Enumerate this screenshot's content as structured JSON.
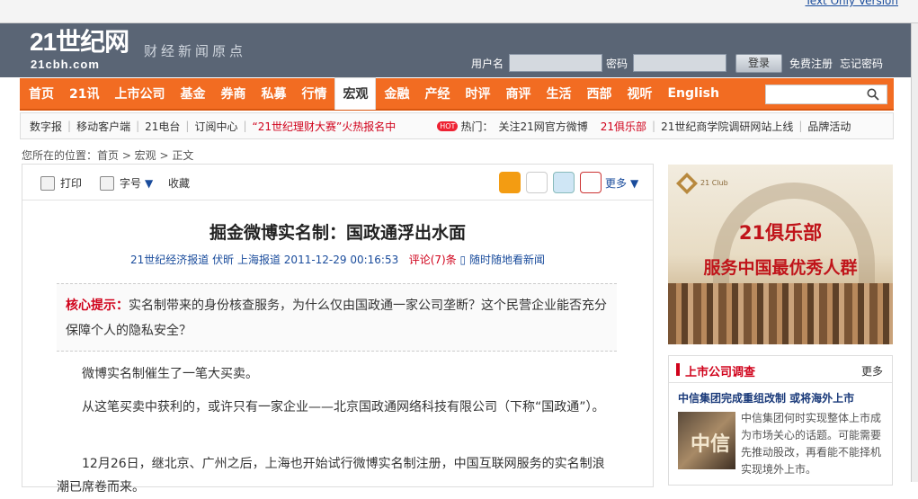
{
  "top": {
    "text_only_link": "Text Only Version"
  },
  "header": {
    "logo": "21世纪网",
    "logo_sub": "21cbh.com",
    "slogan": "财经新闻原点",
    "login": {
      "username_label": "用户名",
      "password_label": "密码",
      "login_button": "登录",
      "register": "免费注册",
      "forgot": "忘记密码"
    }
  },
  "nav": {
    "items": [
      "首页",
      "21讯",
      "上市公司",
      "基金",
      "券商",
      "私募",
      "行情",
      "宏观",
      "金融",
      "产经",
      "时评",
      "商评",
      "生活",
      "西部",
      "视听",
      "English"
    ],
    "active": "宏观"
  },
  "subnav": {
    "items": [
      "数字报",
      "移动客户端",
      "21电台",
      "订阅中心"
    ],
    "promo": "“21世纪理财大赛”火热报名中",
    "hot_badge": "HOT",
    "hot_label": "热门：",
    "hot_items": [
      "关注21网官方微博",
      "21俱乐部",
      "21世纪商学院调研网站上线"
    ],
    "brand": "品牌活动"
  },
  "breadcrumb": "您所在的位置：首页 > 宏观 >  正文",
  "toolbar": {
    "print": "打印",
    "font_size": "字号",
    "favorite": "收藏",
    "more": "更多"
  },
  "article": {
    "title": "掘金微博实名制：国政通浮出水面",
    "source": "21世纪经济报道",
    "author": "伏昕",
    "location": "上海报道",
    "datetime": "2011-12-29 00:16:53",
    "comments": "评论(7)条",
    "mobile": "随时随地看新闻",
    "summary_label": "核心提示：",
    "summary": "实名制带来的身份核查服务，为什么仅由国政通一家公司垄断？这个民营企业能否充分保障个人的隐私安全？",
    "paragraphs": [
      "微博实名制催生了一笔大买卖。",
      "从这笔买卖中获利的，或许只有一家企业——北京国政通网络科技有限公司（下称“国政通”）。",
      "12月26日，继北京、广州之后，上海也开始试行微博实名制注册，中国互联网服务的实名制浪潮已席卷而来。"
    ]
  },
  "ad": {
    "club_tag": "21 Club",
    "line1": "21俱乐部",
    "line2": "服务中国最优秀人群"
  },
  "sidebar": {
    "title": "上市公司调查",
    "more": "更多",
    "headline": "中信集团完成重组改制  或将海外上市",
    "image_text": "中信",
    "text": "中信集团何时实现整体上市成为市场关心的话题。可能需要先推动股改，再看能不能择机实现境外上市。"
  }
}
